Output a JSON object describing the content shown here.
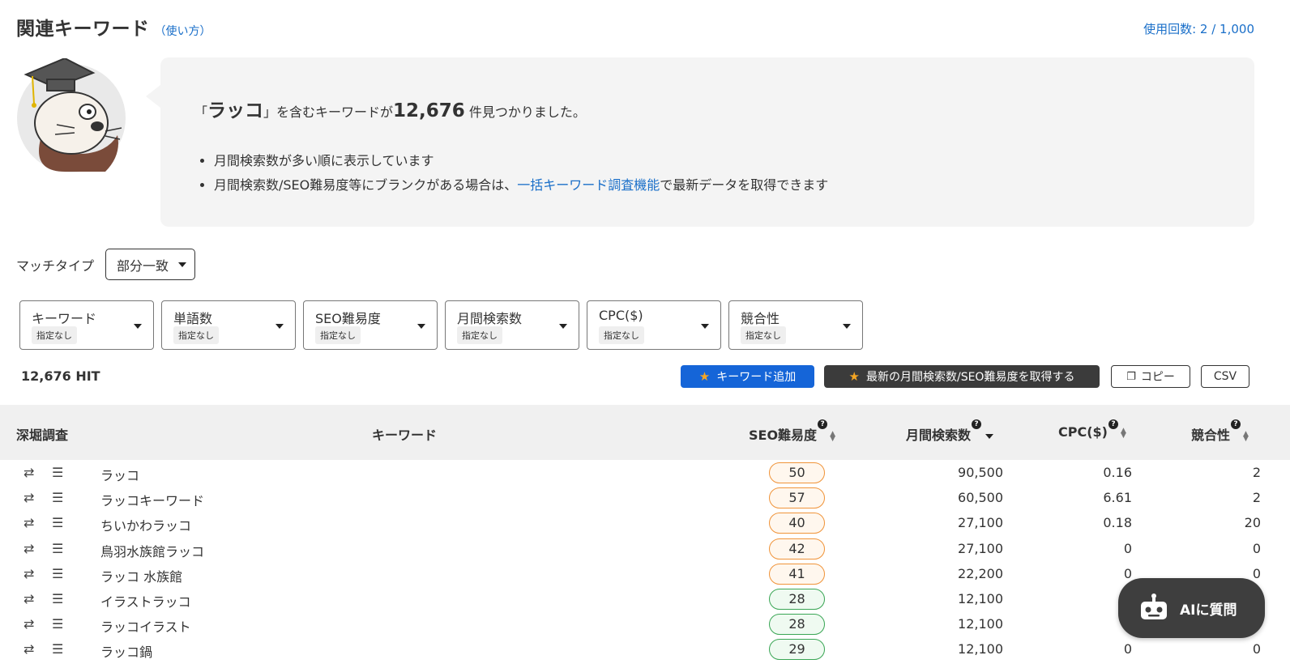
{
  "header": {
    "title": "関連キーワード",
    "howto_link": "（使い方）",
    "usage": "使用回数: 2 / 1,000"
  },
  "summary": {
    "open_quote": "「",
    "query": "ラッコ",
    "close_quote": "」",
    "text_before_count": "を含むキーワードが",
    "count": "12,676",
    "text_after_count": "件見つかりました。",
    "note_1": "月間検索数が多い順に表示しています",
    "note_2_before": "月間検索数/SEO難易度等にブランクがある場合は、",
    "note_2_link": "一括キーワード調査機能",
    "note_2_after": "で最新データを取得できます"
  },
  "match_type": {
    "label": "マッチタイプ",
    "value": "部分一致"
  },
  "filters": [
    {
      "label": "キーワード",
      "value": "指定なし"
    },
    {
      "label": "単語数",
      "value": "指定なし"
    },
    {
      "label": "SEO難易度",
      "value": "指定なし"
    },
    {
      "label": "月間検索数",
      "value": "指定なし"
    },
    {
      "label": "CPC($)",
      "value": "指定なし"
    },
    {
      "label": "競合性",
      "value": "指定なし"
    }
  ],
  "toolbar": {
    "hit_count": "12,676 HIT",
    "add_keyword": "キーワード追加",
    "fetch_latest": "最新の月間検索数/SEO難易度を取得する",
    "copy": "コピー",
    "csv": "CSV"
  },
  "table": {
    "columns": {
      "dig": "深堀調査",
      "keyword": "キーワード",
      "seo": "SEO難易度",
      "volume": "月間検索数",
      "cpc": "CPC($)",
      "competition": "競合性"
    },
    "rows": [
      {
        "keyword": "ラッコ",
        "seo": "50",
        "volume": "90,500",
        "cpc": "0.16",
        "competition": "2"
      },
      {
        "keyword": "ラッコキーワード",
        "seo": "57",
        "volume": "60,500",
        "cpc": "6.61",
        "competition": "2"
      },
      {
        "keyword": "ちいかわラッコ",
        "seo": "40",
        "volume": "27,100",
        "cpc": "0.18",
        "competition": "20"
      },
      {
        "keyword": "鳥羽水族館ラッコ",
        "seo": "42",
        "volume": "27,100",
        "cpc": "0",
        "competition": "0"
      },
      {
        "keyword": "ラッコ 水族館",
        "seo": "41",
        "volume": "22,200",
        "cpc": "0",
        "competition": "0"
      },
      {
        "keyword": "イラストラッコ",
        "seo": "28",
        "volume": "12,100",
        "cpc": "",
        "competition": ""
      },
      {
        "keyword": "ラッコイラスト",
        "seo": "28",
        "volume": "12,100",
        "cpc": "",
        "competition": ""
      },
      {
        "keyword": "ラッコ鍋",
        "seo": "29",
        "volume": "12,100",
        "cpc": "0",
        "competition": "0"
      }
    ]
  },
  "ai_button": {
    "label": "AIに質問"
  },
  "colors": {
    "link": "#1a6fc9",
    "primary_button": "#1565d8",
    "dark_button": "#3b3b3b",
    "seo_mid_border": "#f0943a",
    "seo_mid_fill": "#fff7ee",
    "seo_low_border": "#3aa655",
    "seo_low_fill": "#effaf1"
  }
}
